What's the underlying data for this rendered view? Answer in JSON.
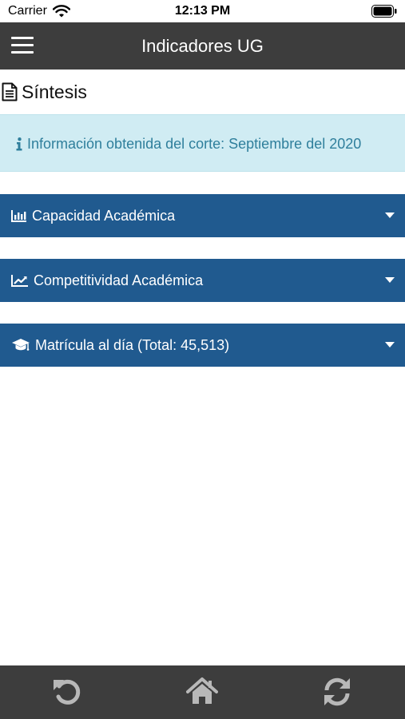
{
  "status_bar": {
    "carrier": "Carrier",
    "time": "12:13 PM",
    "icons": [
      "wifi-icon",
      "battery-icon"
    ]
  },
  "nav_bar": {
    "title": "Indicadores UG",
    "menu_icon": "hamburger-menu-icon"
  },
  "main": {
    "section_title": "Síntesis",
    "section_icon": "document-icon",
    "info_alert": {
      "icon": "info-icon",
      "text": "Información obtenida del corte: Septiembre del 2020"
    },
    "accordions": [
      {
        "icon": "bar-chart-icon",
        "label": "Capacidad Académica"
      },
      {
        "icon": "line-chart-icon",
        "label": "Competitividad Académica"
      },
      {
        "icon": "graduation-cap-icon",
        "label": "Matrícula al día (Total: 45,513)"
      }
    ]
  },
  "bottom_bar": {
    "icons": [
      "undo-icon",
      "home-icon",
      "refresh-icon"
    ]
  },
  "colors": {
    "nav_bar_bg": "#3d3d3d",
    "accordion_bg": "#205a8f",
    "info_bg": "#d0ecf3",
    "info_text": "#2f7f9c"
  }
}
